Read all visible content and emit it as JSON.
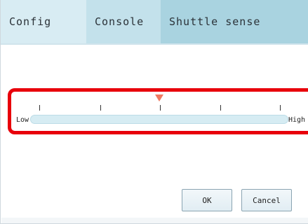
{
  "tabs": [
    {
      "label": "Config"
    },
    {
      "label": "Console"
    },
    {
      "label": "Shuttle sense"
    }
  ],
  "slider": {
    "low_label": "Low",
    "high_label": "High",
    "tick_count": 5,
    "value_fraction": 0.5,
    "marker_color": "#f07a62",
    "track_color": "#d6ecf3",
    "highlight_color": "#e8000b"
  },
  "buttons": {
    "ok": "OK",
    "cancel": "Cancel"
  },
  "colors": {
    "tab_active": "#d8ecf3",
    "tab_mid": "#c3e1eb",
    "tab_bar": "#a9d3e0"
  }
}
